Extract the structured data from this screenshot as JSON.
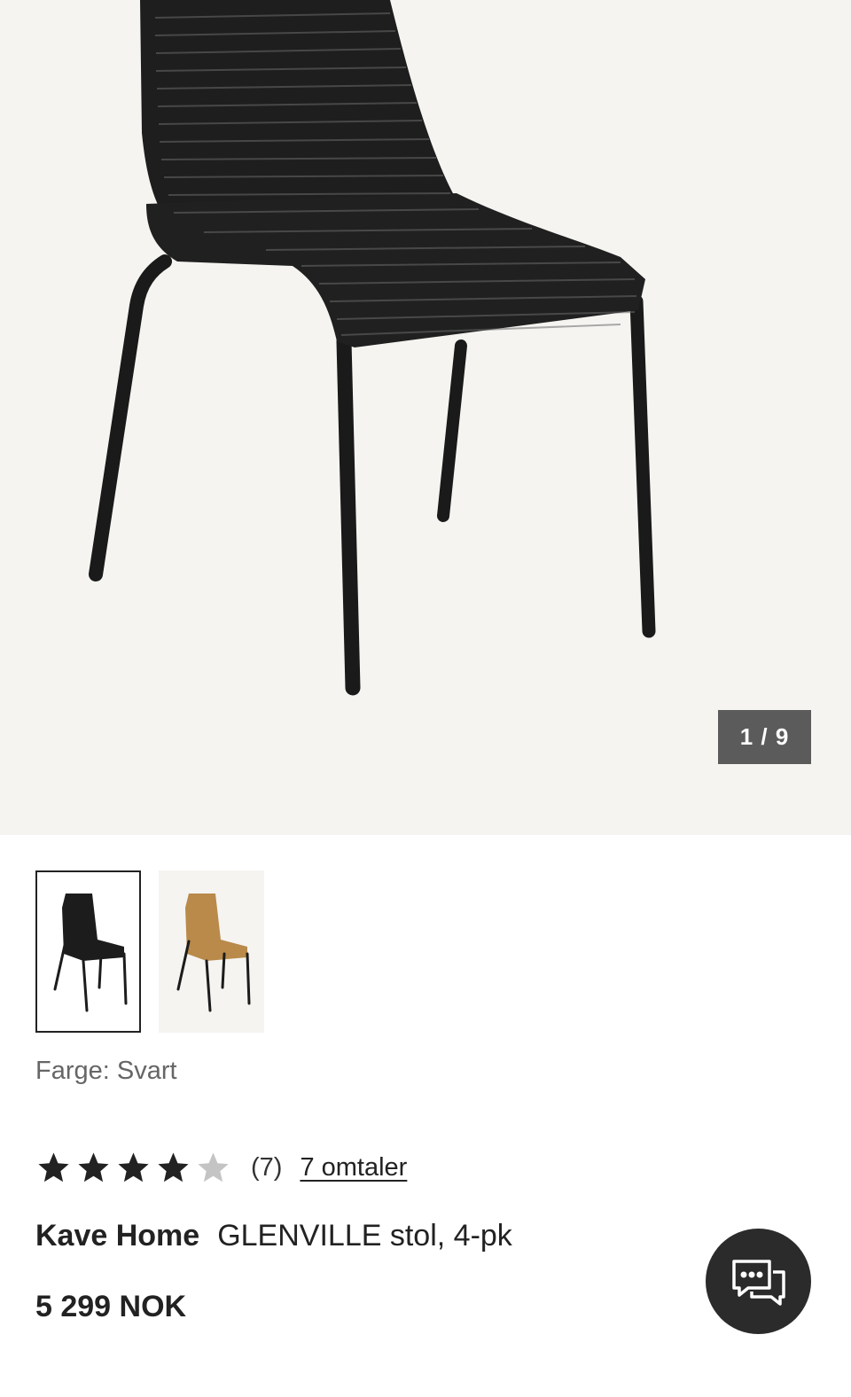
{
  "gallery": {
    "counter": "1 / 9",
    "thumbnails": [
      {
        "color_name": "black chair",
        "color": "#1c1c1c",
        "selected": true
      },
      {
        "color_name": "natural chair",
        "color": "#b98a4a",
        "selected": false
      }
    ]
  },
  "color_selection": {
    "text": "Farge: Svart"
  },
  "rating": {
    "stars": 4,
    "max": 5,
    "count": "(7)",
    "reviews_link": "7 omtaler"
  },
  "product": {
    "brand": "Kave Home",
    "name": "GLENVILLE stol, 4-pk",
    "price": "5 299 NOK"
  },
  "chat": {
    "icon": "chat-bubbles-icon"
  }
}
